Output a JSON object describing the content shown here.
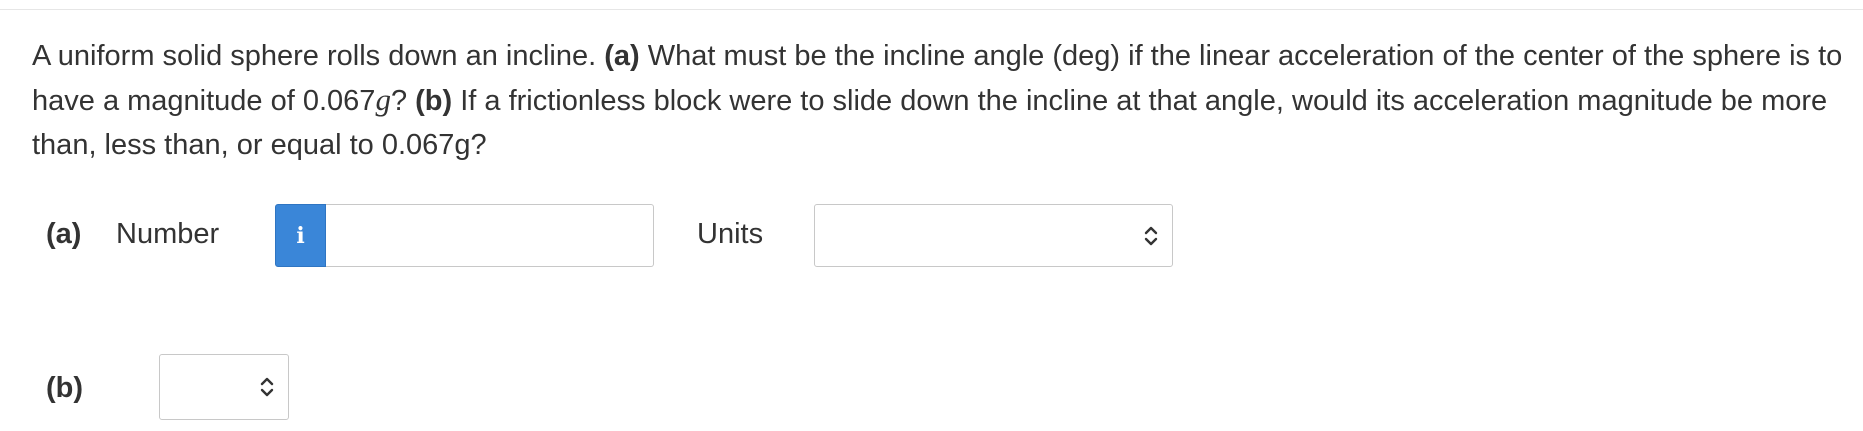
{
  "question": {
    "intro": "A uniform solid sphere rolls down an incline. ",
    "part_a_tag": "(a)",
    "part_a_text": " What must be the incline angle (deg) if the linear acceleration of the center of the sphere is to have a magnitude of 0.067",
    "g_symbol": "g",
    "part_a_end": "? ",
    "part_b_tag": "(b)",
    "part_b_text": " If a frictionless block were to slide down the incline at that angle, would its acceleration magnitude be more than, less than, or equal to 0.067g?"
  },
  "part_a": {
    "label": "(a)",
    "number_label": "Number",
    "info_icon": "i",
    "number_value": "",
    "units_label": "Units",
    "units_selected": ""
  },
  "part_b": {
    "label": "(b)",
    "selected": ""
  }
}
